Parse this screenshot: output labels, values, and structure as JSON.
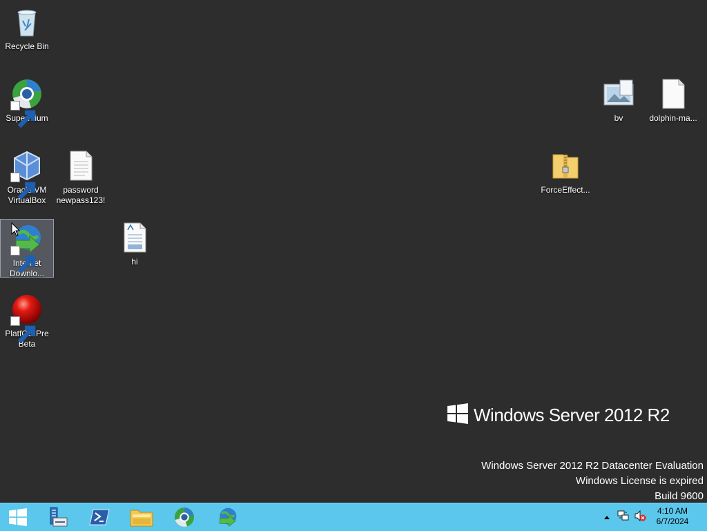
{
  "desktop": {
    "icons": [
      {
        "id": "recycle-bin",
        "lines": [
          "Recycle Bin"
        ]
      },
      {
        "id": "supermium",
        "lines": [
          "Supermium"
        ]
      },
      {
        "id": "virtualbox",
        "lines": [
          "Oracle VM",
          "VirtualBox"
        ]
      },
      {
        "id": "password-file",
        "lines": [
          "password",
          "newpass123!"
        ]
      },
      {
        "id": "internet-download",
        "lines": [
          "Internet",
          "Downlo..."
        ]
      },
      {
        "id": "hi-doc",
        "lines": [
          "hi"
        ]
      },
      {
        "id": "platfos",
        "lines": [
          "PlatfOS Pre",
          "Beta"
        ]
      },
      {
        "id": "bv",
        "lines": [
          "bv"
        ]
      },
      {
        "id": "dolphin",
        "lines": [
          "dolphin-ma..."
        ]
      },
      {
        "id": "forceeffect",
        "lines": [
          "ForceEffect..."
        ]
      }
    ]
  },
  "watermark": {
    "product": "Windows Server 2012 R2",
    "lines": [
      "Windows Server 2012 R2 Datacenter Evaluation",
      "Windows License is expired",
      "Build 9600"
    ]
  },
  "taskbar": {
    "buttons": [
      "start-button",
      "server-manager",
      "powershell",
      "file-explorer",
      "supermium",
      "internet-download-manager"
    ],
    "clock": {
      "time": "4:10 AM",
      "date": "6/7/2024"
    }
  },
  "colors": {
    "desktop": "#2d2d2d",
    "taskbar": "#5bc7ec"
  }
}
